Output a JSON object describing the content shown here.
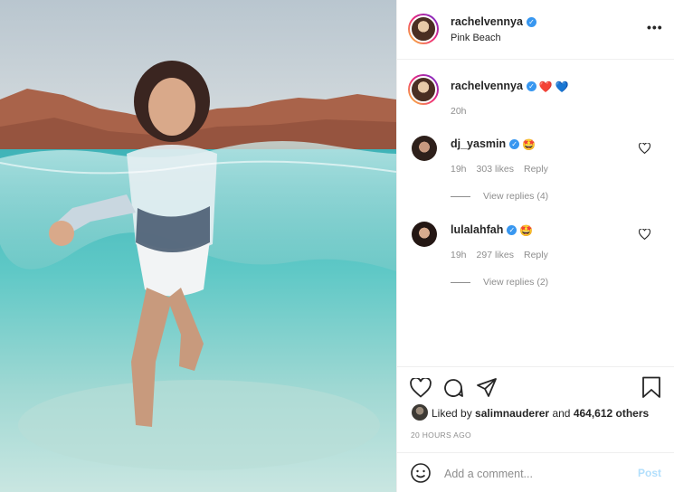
{
  "post": {
    "author": "rachelvennya",
    "location": "Pink Beach",
    "more_label": "•••"
  },
  "caption": {
    "username": "rachelvennya",
    "emojis": [
      "❤️",
      "💙"
    ],
    "time": "20h"
  },
  "comments": [
    {
      "username": "dj_yasmin",
      "emoji": "🤩",
      "time": "19h",
      "likes": "303 likes",
      "reply_label": "Reply",
      "view_replies": "View replies (4)"
    },
    {
      "username": "lulalahfah",
      "emoji": "🤩",
      "time": "19h",
      "likes": "297 likes",
      "reply_label": "Reply",
      "view_replies": "View replies (2)"
    }
  ],
  "engagement": {
    "liked_by_prefix": "Liked by",
    "liked_by_user": "salimnauderer",
    "and_label": "and",
    "others_count": "464,612 others",
    "timestamp": "20 HOURS AGO"
  },
  "comment_box": {
    "placeholder": "Add a comment...",
    "post_label": "Post"
  },
  "icons": {
    "like": "heart-icon",
    "comment": "comment-icon",
    "share": "share-icon",
    "save": "bookmark-icon",
    "emoji": "smiley-icon",
    "verified": "verified-badge-icon",
    "more": "more-icon"
  },
  "colors": {
    "verified": "#3897f0",
    "muted": "#8e8e8e",
    "post_button": "#b2dffc"
  }
}
